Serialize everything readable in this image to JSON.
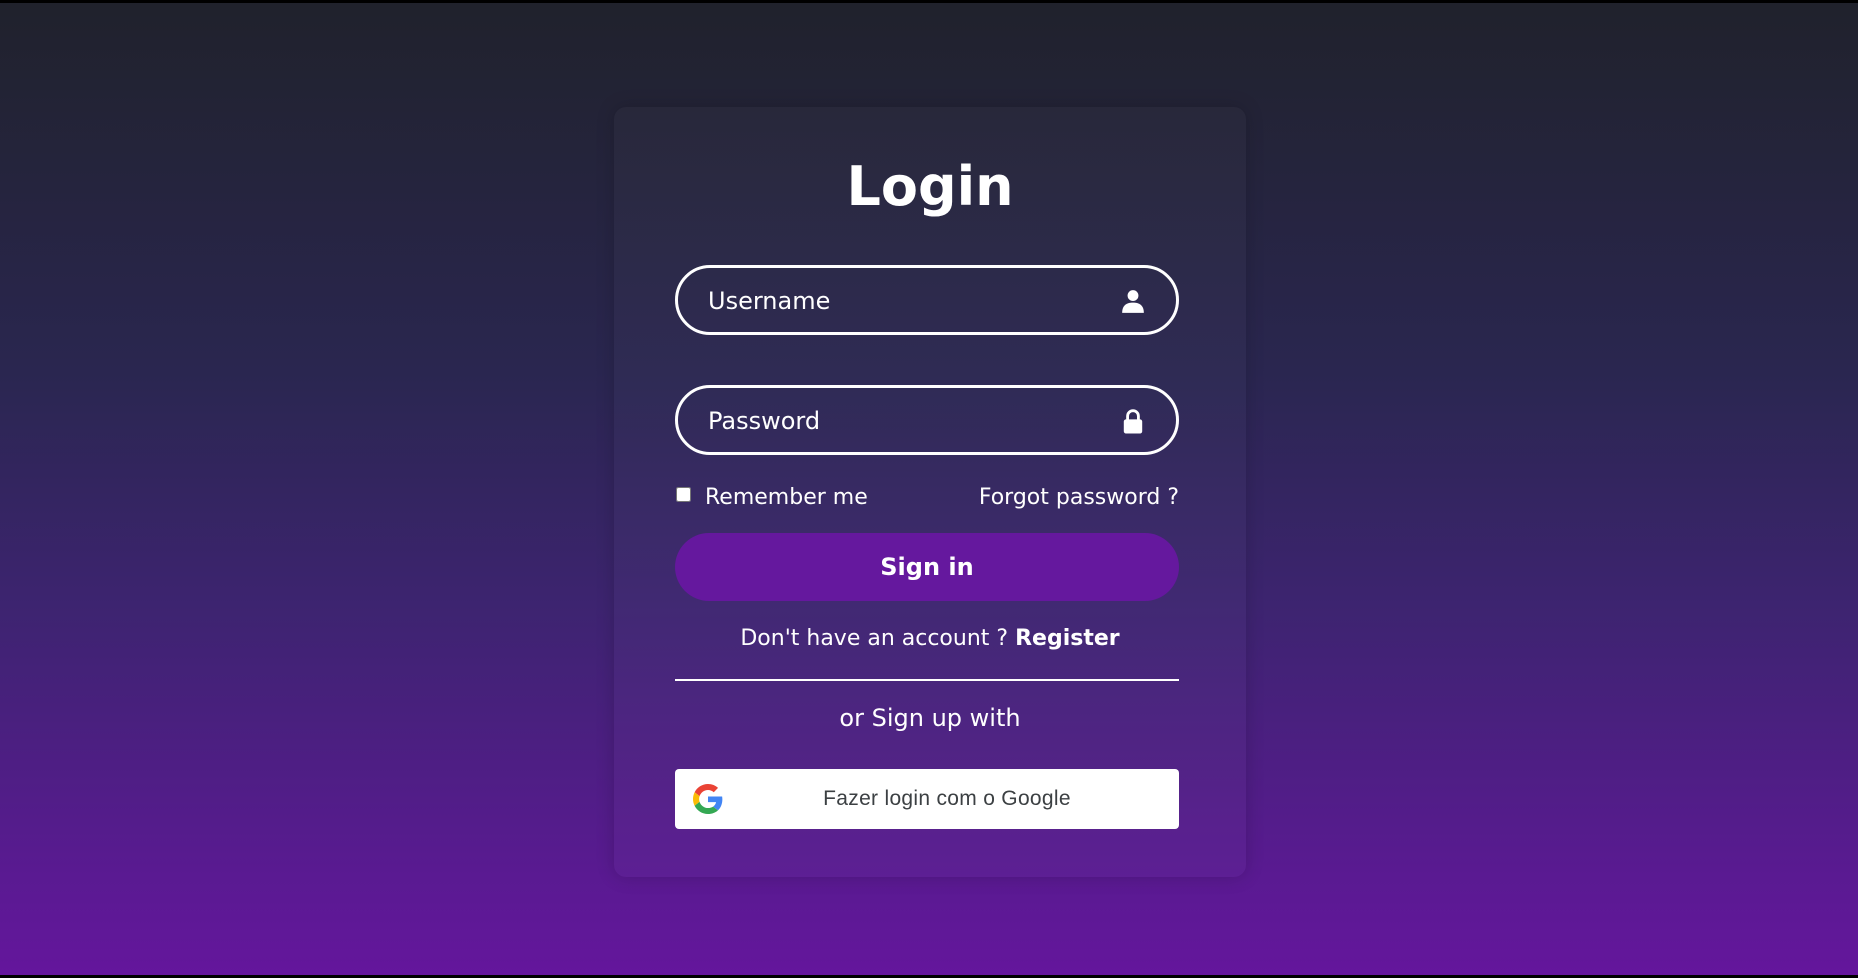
{
  "login": {
    "title": "Login",
    "username_placeholder": "Username",
    "password_placeholder": "Password",
    "remember_label": "Remember me",
    "forgot_label": "Forgot password ?",
    "signin_label": "Sign in",
    "no_account_text": "Don't have an account ? ",
    "register_label": "Register",
    "or_text": "or Sign up with",
    "google_label": "Fazer login com o Google"
  },
  "icons": {
    "username": "user-icon",
    "password": "lock-icon",
    "google": "google-g-icon"
  },
  "colors": {
    "accent": "#65189e",
    "text": "#ffffff",
    "background_top": "#20222c",
    "background_bottom": "#64169c"
  }
}
